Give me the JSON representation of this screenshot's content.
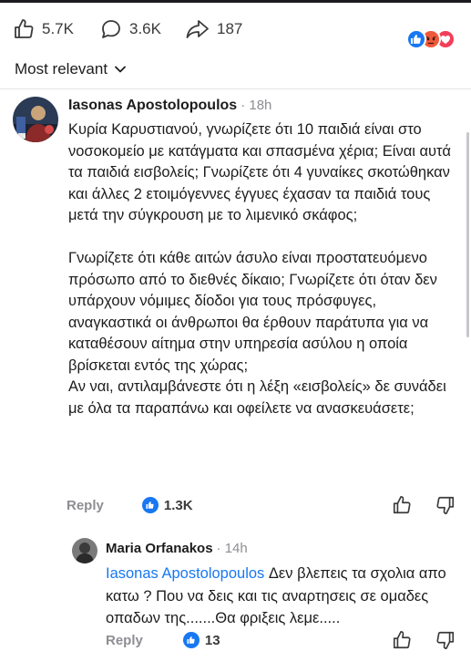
{
  "stats": {
    "likes": "5.7K",
    "comments": "3.6K",
    "shares": "187",
    "like_icon": "thumbs-up-icon",
    "comment_icon": "comment-bubble-icon",
    "share_icon": "share-arrow-icon",
    "reaction_icons": [
      "like-reaction-icon",
      "angry-reaction-icon",
      "love-reaction-icon"
    ]
  },
  "sort": {
    "label": "Most relevant",
    "icon": "chevron-down-icon"
  },
  "comment": {
    "author": "Iasonas Apostolopoulos",
    "time": "· 18h",
    "paragraph1": "Κυρία Καρυστιανού, γνωρίζετε ότι 10 παιδιά είναι στο νοσοκομείο με κατάγματα και σπασμένα χέρια; Είναι αυτά τα παιδιά εισβολείς; Γνωρίζετε ότι 4 γυναίκες σκοτώθηκαν και άλλες 2 ετοιμόγεννες έγγυες έχασαν τα παιδιά τους μετά την σύγκρουση με το λιμενικό σκάφος;",
    "paragraph2": "Γνωρίζετε ότι κάθε αιτών άσυλο είναι προστατευόμενο πρόσωπο από το διεθνές δίκαιο; Γνωρίζετε ότι όταν δεν υπάρχουν νόμιμες δίοδοι για τους πρόσφυγες, αναγκαστικά οι άνθρωποι θα έρθουν παράτυπα για να καταθέσουν αίτημα στην υπηρεσία ασύλου η οποία βρίσκεται εντός της χώρας;",
    "paragraph3": "Αν ναι, αντιλαμβάνεστε ότι η λέξη «εισβολείς» δε συνάδει με όλα τα παραπάνω και οφείλετε να ανασκευάσετε;",
    "reply_label": "Reply",
    "like_count": "1.3K"
  },
  "reply": {
    "author": "Maria Orfanakos",
    "time": "· 14h",
    "mention": "Iasonas Apostolopoulos",
    "text": " Δεν βλεπεις τα σχολια απο κατω ? Που να δεις και τις αναρτησεις σε ομαδες οπαδων της.......Θα φριξεις λεμε.....",
    "reply_label": "Reply",
    "like_count": "13"
  },
  "colors": {
    "accent": "#1877f2",
    "secondary_text": "#8e8e93"
  }
}
